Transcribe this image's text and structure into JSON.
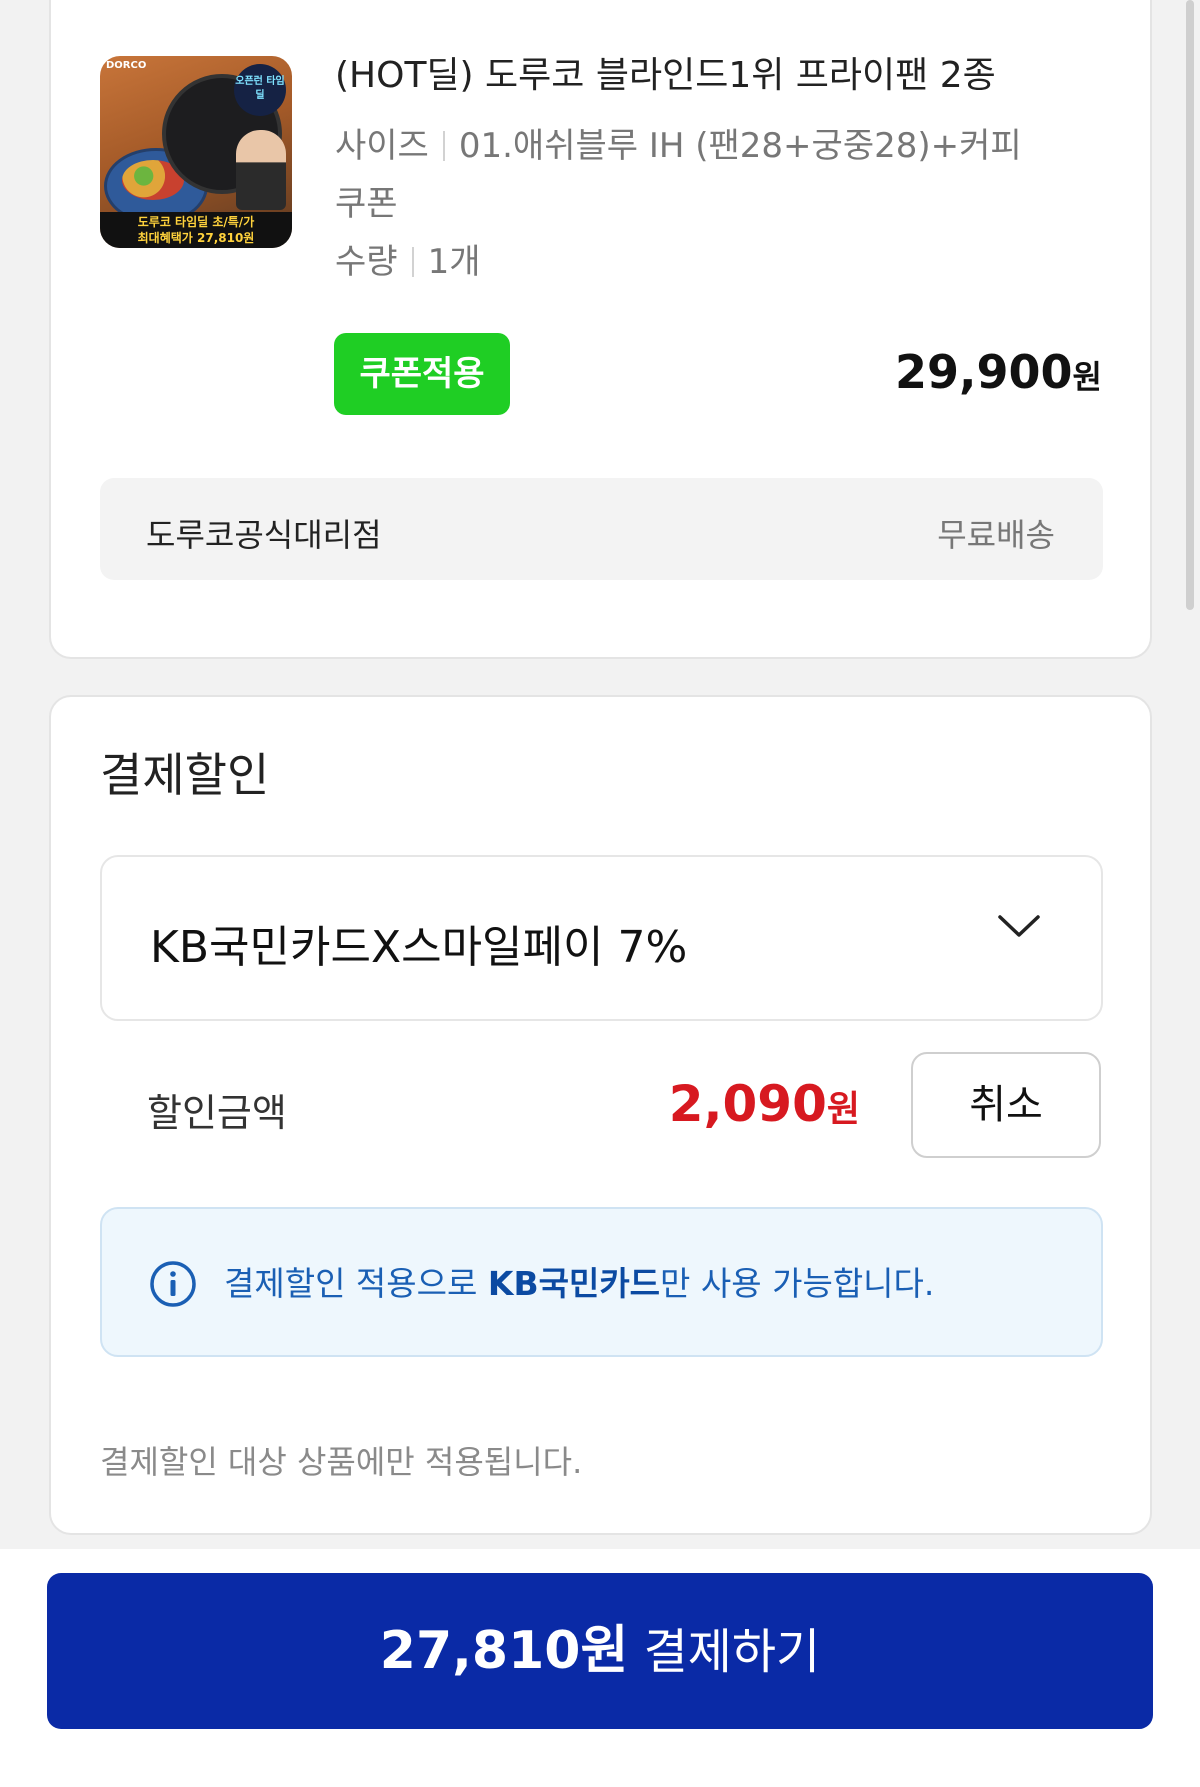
{
  "product": {
    "title": "(HOT딜) 도루코 블라인드1위 프라이팬 2종 …",
    "option_label": "사이즈",
    "option_value": "01.애쉬블루 IH (팬28+궁중28)+커피",
    "option_value_cont": "쿠폰",
    "qty_label": "수량",
    "qty_value": "1개",
    "coupon_button": "쿠폰적용",
    "price": "29,900",
    "price_unit": "원",
    "thumbnail": {
      "brand": "DORCO",
      "badge": "오픈런 타임딜",
      "caption_line1": "도루코 타임딜 초/특/가",
      "caption_line2": "최대혜택가 27,810원"
    },
    "seller": "도루코공식대리점",
    "shipping": "무료배송"
  },
  "discount": {
    "title": "결제할인",
    "selected_card": "KB국민카드X스마일페이 7%",
    "amount_label": "할인금액",
    "amount_value": "2,090",
    "amount_unit": "원",
    "cancel_button": "취소",
    "info_pre": "결제할인 적용으로 ",
    "info_strong": "KB국민카드",
    "info_post": "만 사용 가능합니다.",
    "note": "결제할인 대상 상품에만 적용됩니다."
  },
  "pay": {
    "amount": "27,810원",
    "label": "결제하기"
  },
  "colors": {
    "coupon_green": "#1fce24",
    "discount_red": "#d71920",
    "pay_blue": "#0a2aa6",
    "info_blue": "#1a5fb4"
  }
}
